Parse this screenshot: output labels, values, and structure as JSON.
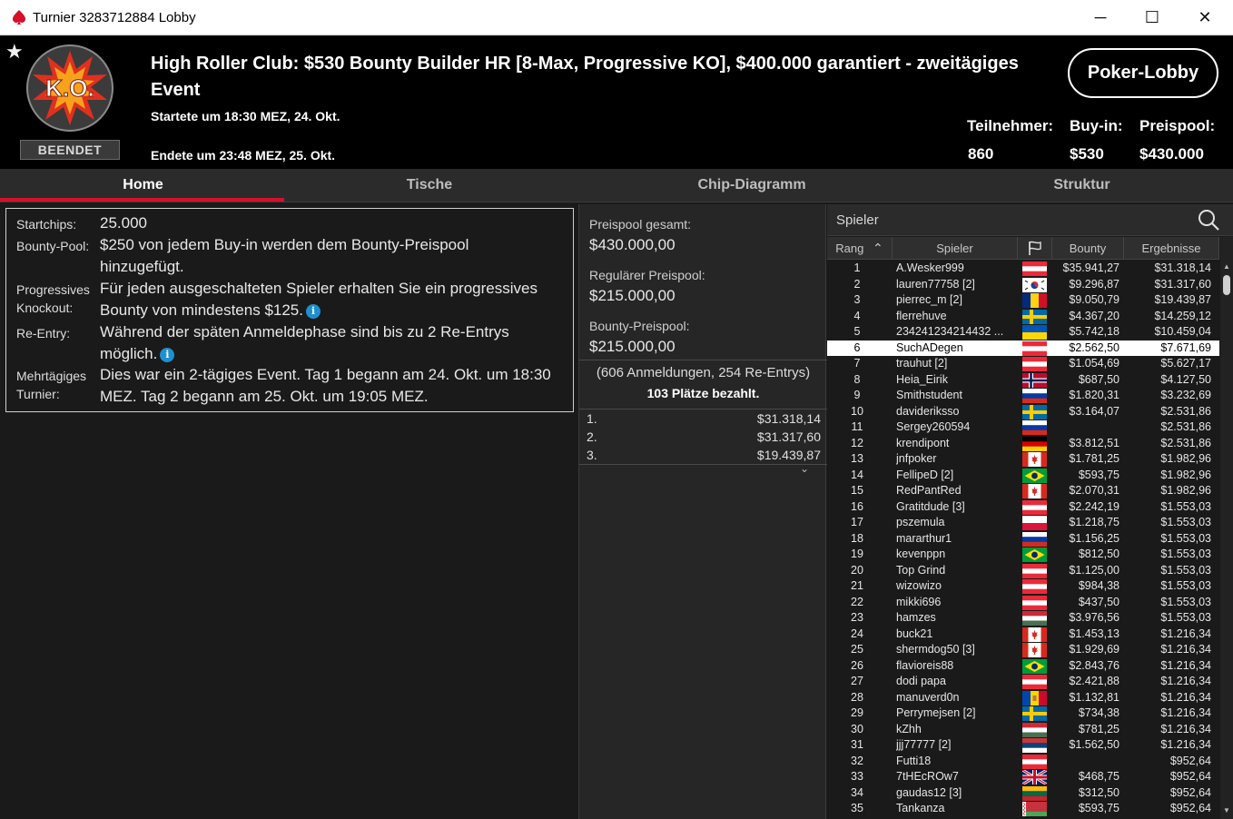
{
  "window": {
    "title": "Turnier 3283712884 Lobby",
    "minimize": "─",
    "maximize": "☐",
    "close": "✕"
  },
  "header": {
    "favorite_icon": "star-icon",
    "logo_text": "K.O.",
    "status": "BEENDET",
    "title": "High Roller Club: $530 Bounty Builder HR [8-Max, Progressive KO], $400.000 garantiert - zweitägiges Event",
    "started": "Startete um 18:30 MEZ, 24. Okt.",
    "ended": "Endete um 23:48 MEZ, 25. Okt.",
    "lobby_button": "Poker-Lobby",
    "stats": [
      {
        "label": "Teilnehmer:",
        "value": "860"
      },
      {
        "label": "Buy-in:",
        "value": "$530"
      },
      {
        "label": "Preispool:",
        "value": "$430.000"
      }
    ],
    "accent_color": "#d6102a"
  },
  "tabs": [
    "Home",
    "Tische",
    "Chip-Diagramm",
    "Struktur"
  ],
  "active_tab": "Home",
  "info": {
    "startchips_label": "Startchips:",
    "startchips_value": "25.000",
    "bounty_label": "Bounty-Pool:",
    "bounty_value_1": "$250 von jedem Buy-in werden dem Bounty-Preispool",
    "bounty_value_2": "hinzugefügt.",
    "pko_label_1": "Progressives",
    "pko_label_2": "Knockout:",
    "pko_value_1": "Für jeden ausgeschalteten Spieler erhalten Sie ein progressives",
    "pko_value_2": "Bounty von mindestens $125.",
    "reentry_label": "Re-Entry:",
    "reentry_value_1": "Während der späten Anmeldephase sind bis zu 2 Re-Entrys",
    "reentry_value_2": "möglich.",
    "multiday_label_1": "Mehrtägiges",
    "multiday_label_2": "Turnier:",
    "multiday_value_1": "Dies war ein 2-tägiges Event. Tag 1 begann am 24. Okt. um 18:30",
    "multiday_value_2": "MEZ. Tag 2 begann am 25. Okt. um 19:05 MEZ.",
    "info_icon_glyph": "i"
  },
  "prizes": {
    "total_label": "Preispool gesamt:",
    "total_value": "$430.000,00",
    "regular_label": "Regulärer Preispool:",
    "regular_value": "$215.000,00",
    "bounty_label": "Bounty-Preispool:",
    "bounty_value": "$215.000,00",
    "registrations": "(606 Anmeldungen, 254 Re-Entrys)",
    "paid": "103 Plätze bezahlt.",
    "places": [
      {
        "pos": "1.",
        "amount": "$31.318,14"
      },
      {
        "pos": "2.",
        "amount": "$31.317,60"
      },
      {
        "pos": "3.",
        "amount": "$19.439,87"
      }
    ],
    "expand_glyph": "⌄"
  },
  "players": {
    "search_label": "Spieler",
    "columns": {
      "rank": "Rang",
      "player": "Spieler",
      "bounty": "Bounty",
      "results": "Ergebnisse"
    },
    "sort_glyph": "⌃",
    "selected_rank": "6",
    "rows": [
      {
        "rank": "1",
        "name": "A.Wesker999",
        "flag": "at",
        "bounty": "$35.941,27",
        "result": "$31.318,14"
      },
      {
        "rank": "2",
        "name": "lauren77758 [2]",
        "flag": "kr",
        "bounty": "$9.296,87",
        "result": "$31.317,60"
      },
      {
        "rank": "3",
        "name": "pierrec_m [2]",
        "flag": "ro",
        "bounty": "$9.050,79",
        "result": "$19.439,87"
      },
      {
        "rank": "4",
        "name": "flerrehuve",
        "flag": "se",
        "bounty": "$4.367,20",
        "result": "$14.259,12"
      },
      {
        "rank": "5",
        "name": "234241234214432 ...",
        "flag": "ua",
        "bounty": "$5.742,18",
        "result": "$10.459,04"
      },
      {
        "rank": "6",
        "name": "SuchADegen",
        "flag": "at",
        "bounty": "$2.562,50",
        "result": "$7.671,69"
      },
      {
        "rank": "7",
        "name": "trauhut [2]",
        "flag": "at",
        "bounty": "$1.054,69",
        "result": "$5.627,17"
      },
      {
        "rank": "8",
        "name": "Heia_Eirik",
        "flag": "no",
        "bounty": "$687,50",
        "result": "$4.127,50"
      },
      {
        "rank": "9",
        "name": "Smithstudent",
        "flag": "ru",
        "bounty": "$1.820,31",
        "result": "$3.232,69"
      },
      {
        "rank": "10",
        "name": "davideriksso",
        "flag": "se",
        "bounty": "$3.164,07",
        "result": "$2.531,86"
      },
      {
        "rank": "11",
        "name": "Sergey260594",
        "flag": "ru",
        "bounty": "",
        "result": "$2.531,86"
      },
      {
        "rank": "12",
        "name": "krendipont",
        "flag": "de",
        "bounty": "$3.812,51",
        "result": "$2.531,86"
      },
      {
        "rank": "13",
        "name": "jnfpoker",
        "flag": "ca",
        "bounty": "$1.781,25",
        "result": "$1.982,96"
      },
      {
        "rank": "14",
        "name": "FellipeD [2]",
        "flag": "br",
        "bounty": "$593,75",
        "result": "$1.982,96"
      },
      {
        "rank": "15",
        "name": "RedPantRed",
        "flag": "ca",
        "bounty": "$2.070,31",
        "result": "$1.982,96"
      },
      {
        "rank": "16",
        "name": "Gratitdude [3]",
        "flag": "at",
        "bounty": "$2.242,19",
        "result": "$1.553,03"
      },
      {
        "rank": "17",
        "name": "pszemula",
        "flag": "pl",
        "bounty": "$1.218,75",
        "result": "$1.553,03"
      },
      {
        "rank": "18",
        "name": "mararthur1",
        "flag": "ru",
        "bounty": "$1.156,25",
        "result": "$1.553,03"
      },
      {
        "rank": "19",
        "name": "kevenppn",
        "flag": "br",
        "bounty": "$812,50",
        "result": "$1.553,03"
      },
      {
        "rank": "20",
        "name": "Top Grind",
        "flag": "at",
        "bounty": "$1.125,00",
        "result": "$1.553,03"
      },
      {
        "rank": "21",
        "name": "wizowizo",
        "flag": "at",
        "bounty": "$984,38",
        "result": "$1.553,03"
      },
      {
        "rank": "22",
        "name": "mikki696",
        "flag": "at",
        "bounty": "$437,50",
        "result": "$1.553,03"
      },
      {
        "rank": "23",
        "name": "hamzes",
        "flag": "hu",
        "bounty": "$3.976,56",
        "result": "$1.553,03"
      },
      {
        "rank": "24",
        "name": "buck21",
        "flag": "ca",
        "bounty": "$1.453,13",
        "result": "$1.216,34"
      },
      {
        "rank": "25",
        "name": "shermdog50 [3]",
        "flag": "ca",
        "bounty": "$1.929,69",
        "result": "$1.216,34"
      },
      {
        "rank": "26",
        "name": "flavioreis88",
        "flag": "br",
        "bounty": "$2.843,76",
        "result": "$1.216,34"
      },
      {
        "rank": "27",
        "name": "dodi papa",
        "flag": "at",
        "bounty": "$2.421,88",
        "result": "$1.216,34"
      },
      {
        "rank": "28",
        "name": "manuverd0n",
        "flag": "md",
        "bounty": "$1.132,81",
        "result": "$1.216,34"
      },
      {
        "rank": "29",
        "name": "Perrymejsen [2]",
        "flag": "se",
        "bounty": "$734,38",
        "result": "$1.216,34"
      },
      {
        "rank": "30",
        "name": "kZhh",
        "flag": "hu",
        "bounty": "$781,25",
        "result": "$1.216,34"
      },
      {
        "rank": "31",
        "name": "jjj77777 [2]",
        "flag": "rs",
        "bounty": "$1.562,50",
        "result": "$1.216,34"
      },
      {
        "rank": "32",
        "name": "Futti18",
        "flag": "at",
        "bounty": "",
        "result": "$952,64"
      },
      {
        "rank": "33",
        "name": "7tHEcROw7",
        "flag": "gb",
        "bounty": "$468,75",
        "result": "$952,64"
      },
      {
        "rank": "34",
        "name": "gaudas12 [3]",
        "flag": "lt",
        "bounty": "$312,50",
        "result": "$952,64"
      },
      {
        "rank": "35",
        "name": "Tankanza",
        "flag": "by",
        "bounty": "$593,75",
        "result": "$952,64"
      }
    ]
  }
}
